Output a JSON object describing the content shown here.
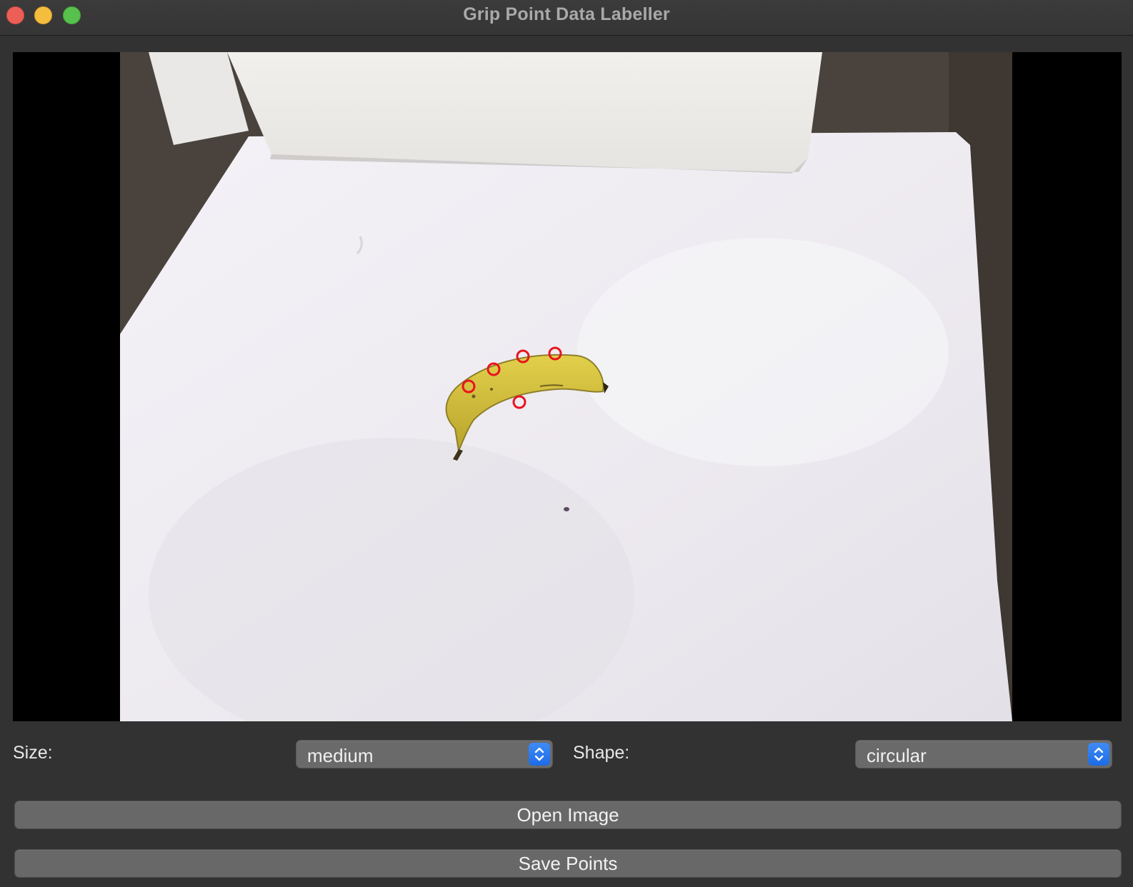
{
  "window": {
    "title": "Grip Point Data Labeller"
  },
  "controls": {
    "size_label": "Size:",
    "size_value": "medium",
    "shape_label": "Shape:",
    "shape_value": "circular"
  },
  "buttons": {
    "open_image": "Open Image",
    "save_points": "Save Points"
  },
  "image": {
    "subject": "banana on white board",
    "grip_point_count": 5,
    "marker_color": "#e8141e"
  },
  "colors": {
    "window_bg": "#323232",
    "accent": "#1f6fe8",
    "button_bg": "#686868"
  }
}
